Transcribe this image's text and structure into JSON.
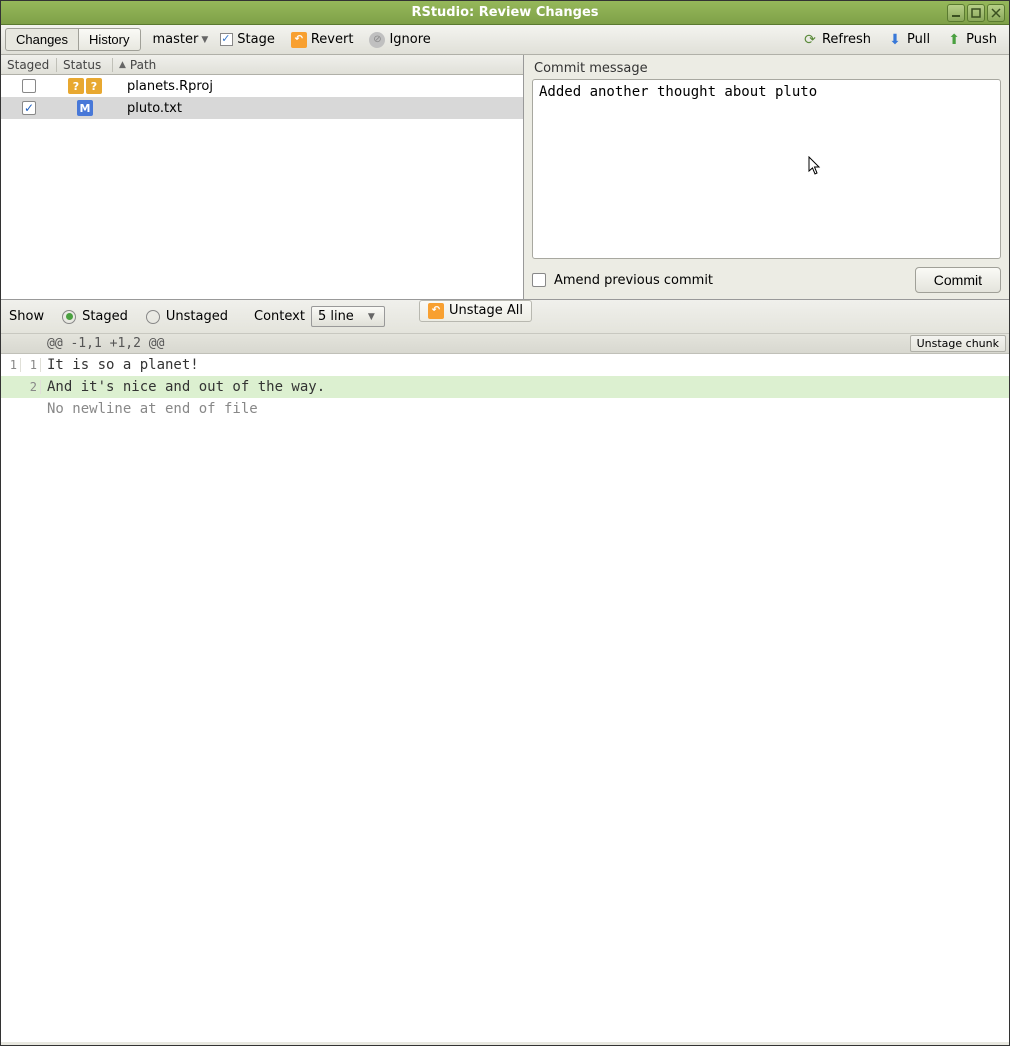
{
  "window": {
    "title": "RStudio: Review Changes"
  },
  "toolbar": {
    "tabs": {
      "changes": "Changes",
      "history": "History"
    },
    "branch": "master",
    "stage": "Stage",
    "revert": "Revert",
    "ignore": "Ignore",
    "refresh": "Refresh",
    "pull": "Pull",
    "push": "Push"
  },
  "file_headers": {
    "staged": "Staged",
    "status": "Status",
    "path": "Path"
  },
  "files": [
    {
      "staged": false,
      "status": [
        "?",
        "?"
      ],
      "status_kind": "q",
      "path": "planets.Rproj",
      "selected": false
    },
    {
      "staged": true,
      "status": [
        "M"
      ],
      "status_kind": "m",
      "path": "pluto.txt",
      "selected": true
    }
  ],
  "commit": {
    "label": "Commit message",
    "text": "Added another thought about pluto",
    "amend_label": "Amend previous commit",
    "amend_checked": false,
    "button": "Commit"
  },
  "diff_toolbar": {
    "show": "Show",
    "staged": "Staged",
    "unstaged": "Unstaged",
    "context": "Context",
    "context_value": "5 line",
    "unstage_all": "Unstage All"
  },
  "diff": {
    "hunk_header": "@@ -1,1 +1,2 @@",
    "unstage_chunk": "Unstage chunk",
    "lines": [
      {
        "old": "1",
        "new": "1",
        "kind": "ctx",
        "text": "It is so a planet!"
      },
      {
        "old": "",
        "new": "2",
        "kind": "added",
        "text": "And it's nice and out of the way."
      },
      {
        "old": "",
        "new": "",
        "kind": "note",
        "text": " No newline at end of file"
      }
    ]
  }
}
